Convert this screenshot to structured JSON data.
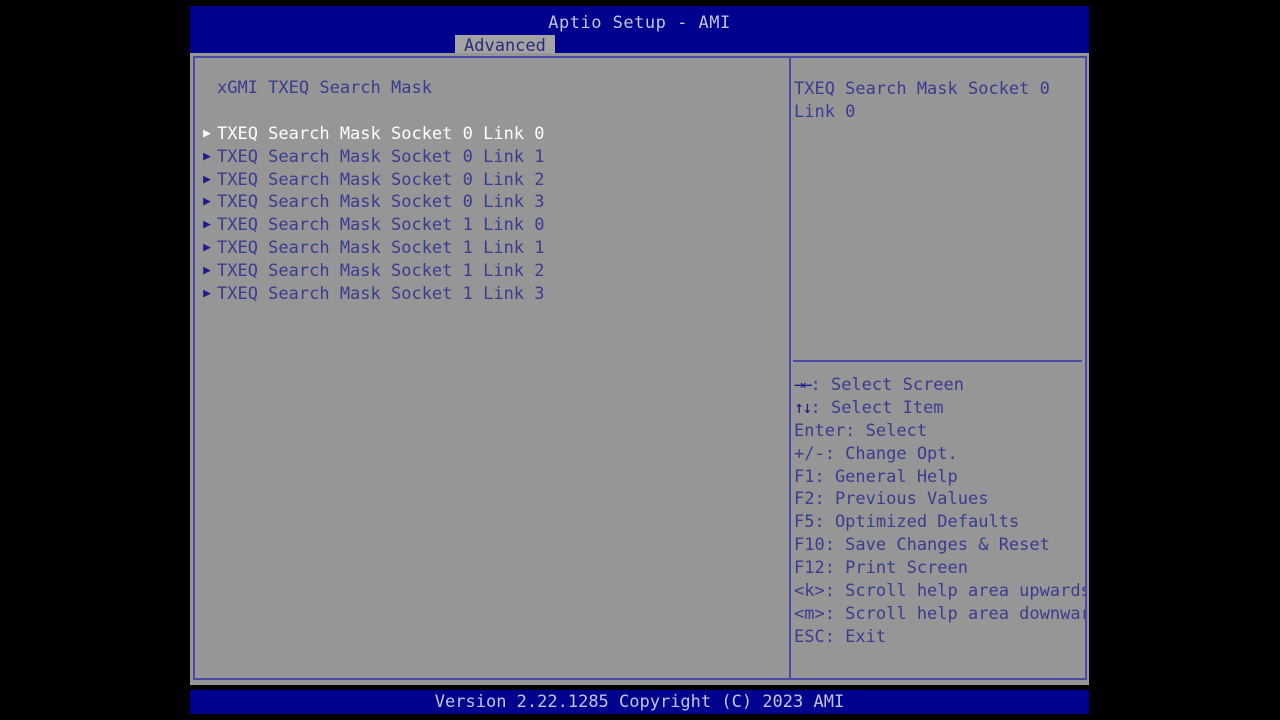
{
  "window": {
    "app_title": "Aptio Setup - AMI"
  },
  "tabs": [
    {
      "label": "Advanced",
      "active": true
    }
  ],
  "left_pane": {
    "section_title": "xGMI TXEQ Search Mask",
    "items": [
      {
        "bullet": "▶",
        "label": "TXEQ Search Mask Socket 0 Link 0",
        "selected": true
      },
      {
        "bullet": "▶",
        "label": "TXEQ Search Mask Socket 0 Link 1",
        "selected": false
      },
      {
        "bullet": "▶",
        "label": "TXEQ Search Mask Socket 0 Link 2",
        "selected": false
      },
      {
        "bullet": "▶",
        "label": "TXEQ Search Mask Socket 0 Link 3",
        "selected": false
      },
      {
        "bullet": "▶",
        "label": "TXEQ Search Mask Socket 1 Link 0",
        "selected": false
      },
      {
        "bullet": "▶",
        "label": "TXEQ Search Mask Socket 1 Link 1",
        "selected": false
      },
      {
        "bullet": "▶",
        "label": "TXEQ Search Mask Socket 1 Link 2",
        "selected": false
      },
      {
        "bullet": "▶",
        "label": "TXEQ Search Mask Socket 1 Link 3",
        "selected": false
      }
    ]
  },
  "right_pane": {
    "help_text": "TXEQ Search Mask Socket 0 Link 0",
    "hotkeys": [
      {
        "glyph": "→←",
        "text": ": Select Screen"
      },
      {
        "glyph": "↑↓",
        "text": ": Select Item"
      },
      {
        "glyph": "",
        "text": "Enter: Select"
      },
      {
        "glyph": "",
        "text": "+/-: Change Opt."
      },
      {
        "glyph": "",
        "text": "F1: General Help"
      },
      {
        "glyph": "",
        "text": "F2: Previous Values"
      },
      {
        "glyph": "",
        "text": "F5: Optimized Defaults"
      },
      {
        "glyph": "",
        "text": "F10: Save Changes & Reset"
      },
      {
        "glyph": "",
        "text": "F12: Print Screen"
      },
      {
        "glyph": "",
        "text": "<k>: Scroll help area upwards"
      },
      {
        "glyph": "",
        "text": "<m>: Scroll help area downwards"
      },
      {
        "glyph": "",
        "text": "ESC: Exit"
      }
    ]
  },
  "footer": {
    "version_text": "Version 2.22.1285 Copyright (C) 2023 AMI"
  },
  "colors": {
    "header_blue": "#00008f",
    "panel_gray": "#969696",
    "text_blue": "#3b3b8f",
    "border_blue": "#4a4aa8",
    "selected_white": "#ffffff",
    "tab_gray": "#a3a3a3"
  }
}
